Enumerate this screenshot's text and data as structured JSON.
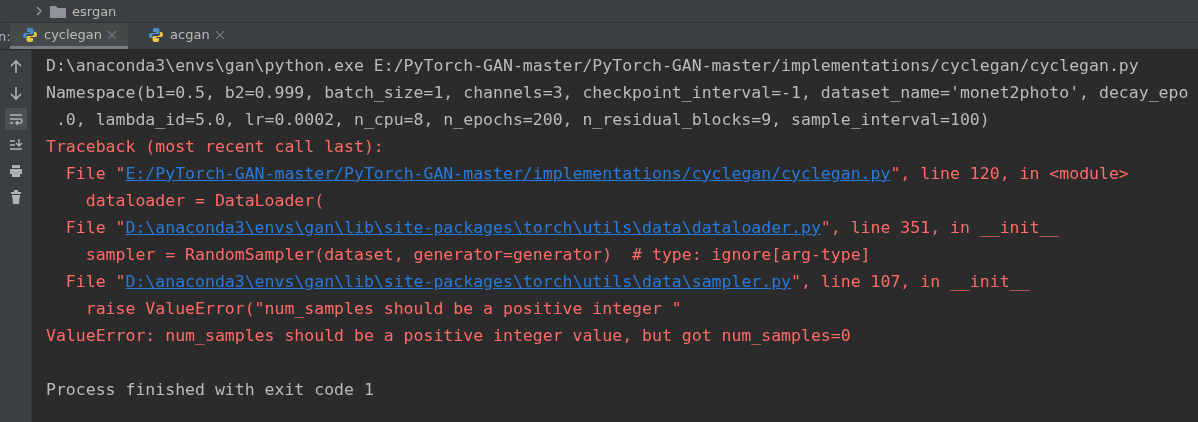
{
  "project_tree": {
    "item": {
      "label": "esrgan",
      "expanded": false
    }
  },
  "run_panel": {
    "label": "n:",
    "tabs": [
      {
        "label": "cyclegan",
        "selected": true
      },
      {
        "label": "acgan",
        "selected": false
      }
    ]
  },
  "toolbar": [
    {
      "kind": "up",
      "selected": false
    },
    {
      "kind": "down",
      "selected": false
    },
    {
      "kind": "wrap",
      "selected": true
    },
    {
      "kind": "scroll-end",
      "selected": false
    },
    {
      "kind": "print",
      "selected": false
    },
    {
      "kind": "trash",
      "selected": false
    }
  ],
  "console_lines": [
    {
      "segments": [
        {
          "kind": "output",
          "text": "D:\\anaconda3\\envs\\gan\\python.exe E:/PyTorch-GAN-master/PyTorch-GAN-master/implementations/cyclegan/cyclegan.py"
        }
      ]
    },
    {
      "segments": [
        {
          "kind": "output",
          "text": "Namespace(b1=0.5, b2=0.999, batch_size=1, channels=3, checkpoint_interval=-1, dataset_name='monet2photo', decay_epo"
        }
      ]
    },
    {
      "segments": [
        {
          "kind": "output",
          "text": " .0, lambda_id=5.0, lr=0.0002, n_cpu=8, n_epochs=200, n_residual_blocks=9, sample_interval=100)"
        }
      ]
    },
    {
      "segments": [
        {
          "kind": "error",
          "text": "Traceback (most recent call last):"
        }
      ]
    },
    {
      "segments": [
        {
          "kind": "error",
          "text": "  File \""
        },
        {
          "kind": "link",
          "text": "E:/PyTorch-GAN-master/PyTorch-GAN-master/implementations/cyclegan/cyclegan.py"
        },
        {
          "kind": "error",
          "text": "\", line 120, in <module>"
        }
      ]
    },
    {
      "segments": [
        {
          "kind": "error",
          "text": "    dataloader = DataLoader("
        }
      ]
    },
    {
      "segments": [
        {
          "kind": "error",
          "text": "  File \""
        },
        {
          "kind": "link",
          "text": "D:\\anaconda3\\envs\\gan\\lib\\site-packages\\torch\\utils\\data\\dataloader.py"
        },
        {
          "kind": "error",
          "text": "\", line 351, in __init__"
        }
      ]
    },
    {
      "segments": [
        {
          "kind": "error",
          "text": "    sampler = RandomSampler(dataset, generator=generator)  # type: ignore[arg-type]"
        }
      ]
    },
    {
      "segments": [
        {
          "kind": "error",
          "text": "  File \""
        },
        {
          "kind": "link",
          "text": "D:\\anaconda3\\envs\\gan\\lib\\site-packages\\torch\\utils\\data\\sampler.py"
        },
        {
          "kind": "error",
          "text": "\", line 107, in __init__"
        }
      ]
    },
    {
      "segments": [
        {
          "kind": "error",
          "text": "    raise ValueError(\"num_samples should be a positive integer \""
        }
      ]
    },
    {
      "segments": [
        {
          "kind": "error",
          "text": "ValueError: num_samples should be a positive integer value, but got num_samples=0"
        }
      ]
    }
  ],
  "exit_message": "Process finished with exit code 1"
}
